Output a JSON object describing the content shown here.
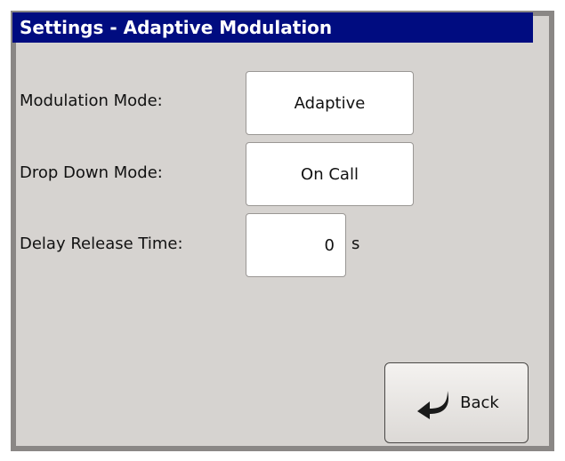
{
  "window": {
    "title": "Settings - Adaptive Modulation"
  },
  "settings": {
    "modulation_mode": {
      "label": "Modulation Mode:",
      "value": "Adaptive"
    },
    "drop_down_mode": {
      "label": "Drop Down Mode:",
      "value": "On Call"
    },
    "delay_release_time": {
      "label": "Delay Release Time:",
      "value": "0",
      "unit": "s"
    }
  },
  "buttons": {
    "back_label": "Back",
    "back_icon": "return-arrow-icon"
  },
  "colors": {
    "title_bar": "#000c80",
    "panel": "#d6d3d0",
    "frame": "#8a8785"
  }
}
